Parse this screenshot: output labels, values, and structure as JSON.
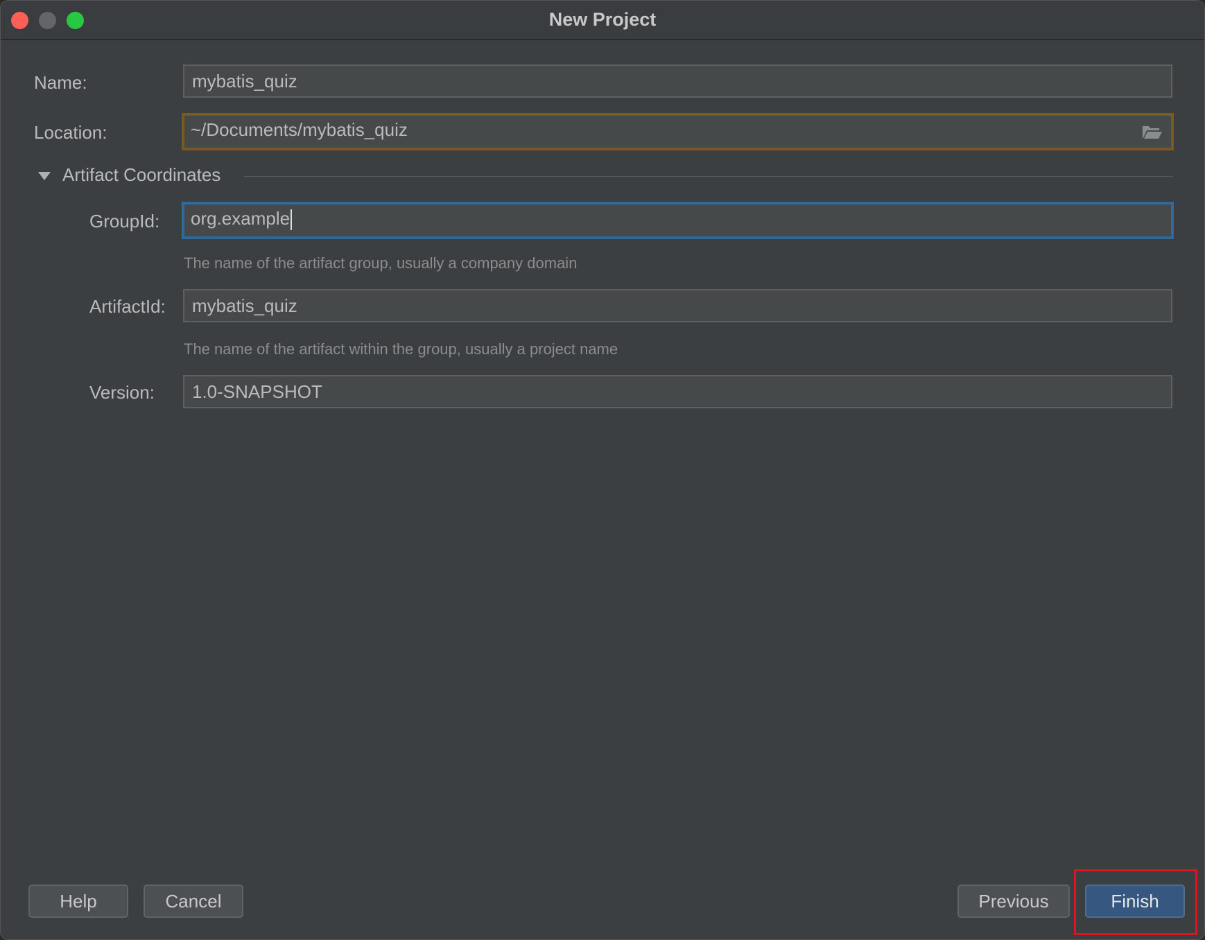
{
  "window": {
    "title": "New Project"
  },
  "form": {
    "name_label": "Name:",
    "name_value": "mybatis_quiz",
    "location_label": "Location:",
    "location_value": "~/Documents/mybatis_quiz",
    "section_title": "Artifact Coordinates",
    "groupid_label": "GroupId:",
    "groupid_value": "org.example",
    "groupid_hint": "The name of the artifact group, usually a company domain",
    "artifactid_label": "ArtifactId:",
    "artifactid_value": "mybatis_quiz",
    "artifactid_hint": "The name of the artifact within the group, usually a project name",
    "version_label": "Version:",
    "version_value": "1.0-SNAPSHOT"
  },
  "buttons": {
    "help": "Help",
    "cancel": "Cancel",
    "previous": "Previous",
    "finish": "Finish"
  },
  "colors": {
    "background": "#3c3f41",
    "field": "#45494a",
    "warning_border": "#7b5a1f",
    "focus_border": "#2f6a9b",
    "primary_button": "#365880",
    "highlight": "#e0141e"
  },
  "icons": {
    "location_browse": "folder-icon",
    "section_toggle": "triangle-down-icon"
  }
}
